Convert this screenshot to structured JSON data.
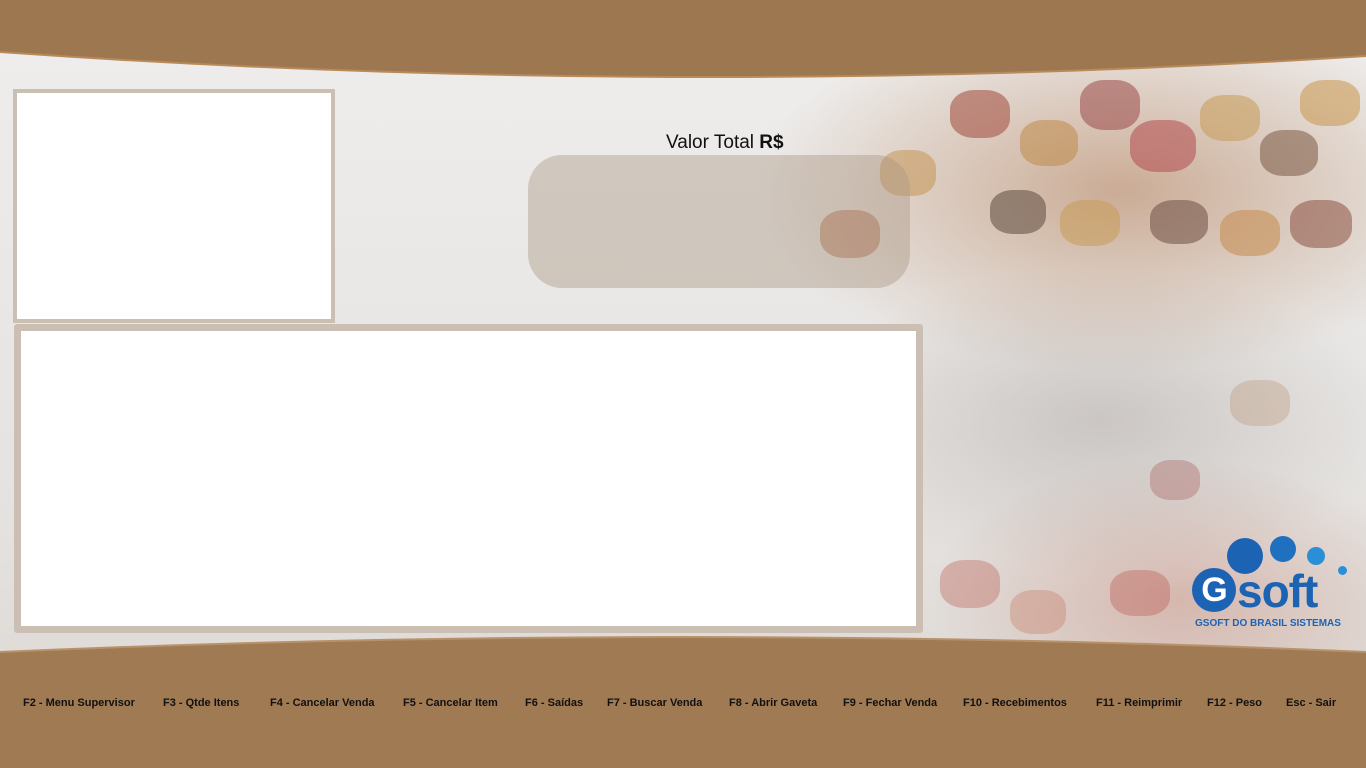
{
  "total": {
    "label": "Valor Total ",
    "currency": "R$"
  },
  "logo": {
    "initial": "G",
    "word": "soft",
    "tagline": "GSOFT DO BRASIL SISTEMAS"
  },
  "function_keys": [
    {
      "id": "f2",
      "label": "F2 - Menu Supervisor"
    },
    {
      "id": "f3",
      "label": "F3 - Qtde Itens"
    },
    {
      "id": "f4",
      "label": "F4 - Cancelar Venda"
    },
    {
      "id": "f5",
      "label": "F5 - Cancelar Item"
    },
    {
      "id": "f6",
      "label": "F6 - Saídas"
    },
    {
      "id": "f7",
      "label": "F7 - Buscar Venda"
    },
    {
      "id": "f8",
      "label": "F8 - Abrir Gaveta"
    },
    {
      "id": "f9",
      "label": "F9 - Fechar Venda"
    },
    {
      "id": "f10",
      "label": "F10 - Recebimentos"
    },
    {
      "id": "f11",
      "label": "F11 - Reimprimir"
    },
    {
      "id": "f12",
      "label": "F12 - Peso"
    },
    {
      "id": "esc",
      "label": "Esc - Sair"
    }
  ],
  "colors": {
    "band": "#9c7750",
    "panel_border": "#cbbfb4",
    "total_box": "#aa9682",
    "logo_blue": "#1c63b3",
    "logo_light_blue": "#2b8fd6"
  }
}
